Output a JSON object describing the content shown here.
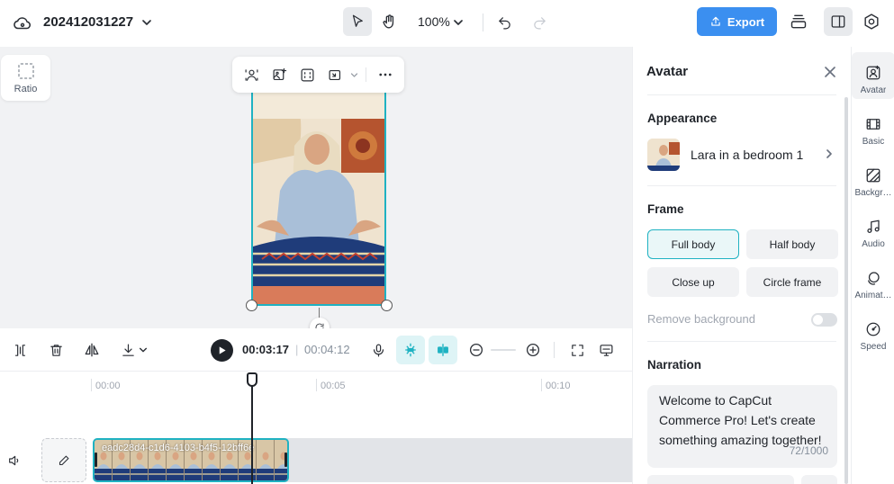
{
  "header": {
    "project_name": "202412031227",
    "zoom": "100%",
    "export_label": "Export"
  },
  "canvas": {
    "ratio_label": "Ratio"
  },
  "playback": {
    "current_time": "00:03:17",
    "separator": "|",
    "total_time": "00:04:12"
  },
  "timeline": {
    "ticks": [
      "00:00",
      "00:05",
      "00:10"
    ],
    "clip_name": "eadc28d4-c1d6-4103-b4f5-12bff6e"
  },
  "panel": {
    "title": "Avatar",
    "appearance": {
      "title": "Appearance",
      "avatar_name": "Lara in a bedroom 1"
    },
    "frame": {
      "title": "Frame",
      "options": [
        "Full body",
        "Half body",
        "Close up",
        "Circle frame"
      ],
      "selected": "Full body"
    },
    "remove_background": {
      "label": "Remove background",
      "enabled": false
    },
    "narration": {
      "title": "Narration",
      "text": "Welcome to CapCut Commerce Pro! Let's create something amazing together!",
      "counter": "72/1000"
    }
  },
  "rail": {
    "items": [
      {
        "label": "Avatar",
        "icon": "avatar-icon",
        "active": true
      },
      {
        "label": "Basic",
        "icon": "film-icon",
        "active": false
      },
      {
        "label": "Backgr…",
        "icon": "background-icon",
        "active": false
      },
      {
        "label": "Audio",
        "icon": "music-note-icon",
        "active": false
      },
      {
        "label": "Animat…",
        "icon": "animation-icon",
        "active": false
      },
      {
        "label": "Speed",
        "icon": "speedometer-icon",
        "active": false
      }
    ]
  },
  "colors": {
    "accent": "#1fb2c2",
    "export_button": "#3b8ff0",
    "canvas_bg": "#f1f2f4"
  }
}
